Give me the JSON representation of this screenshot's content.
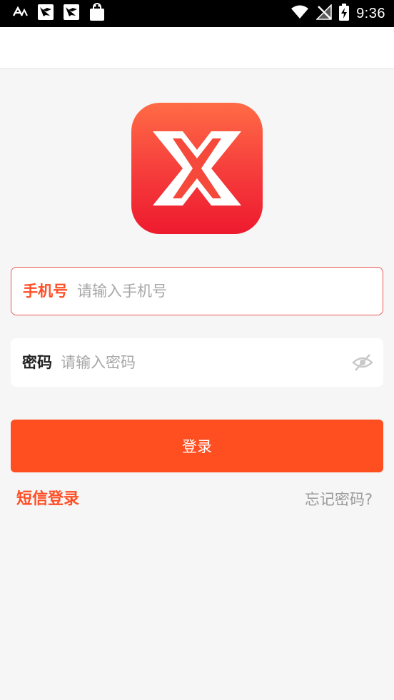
{
  "status_bar": {
    "time": "9:36",
    "icons": [
      "font-a-icon",
      "notification-bird-icon",
      "notification-bird-icon-2",
      "shopping-bag-icon",
      "wifi-icon",
      "no-signal-icon",
      "battery-charging-icon"
    ]
  },
  "logo": {
    "icon": "x-logo-icon",
    "gradient_top": "#ff6b45",
    "gradient_bottom": "#ee1a2e"
  },
  "form": {
    "phone": {
      "label": "手机号",
      "placeholder": "请输入手机号",
      "value": ""
    },
    "password": {
      "label": "密码",
      "placeholder": "请输入密码",
      "value": "",
      "toggle_icon": "eye-hidden-icon"
    },
    "login_button": "登录",
    "sms_login": "短信登录",
    "forgot_password": "忘记密码?"
  },
  "colors": {
    "accent": "#ff4e20",
    "field_border_active": "#ee5a5a",
    "background": "#f6f6f6"
  }
}
